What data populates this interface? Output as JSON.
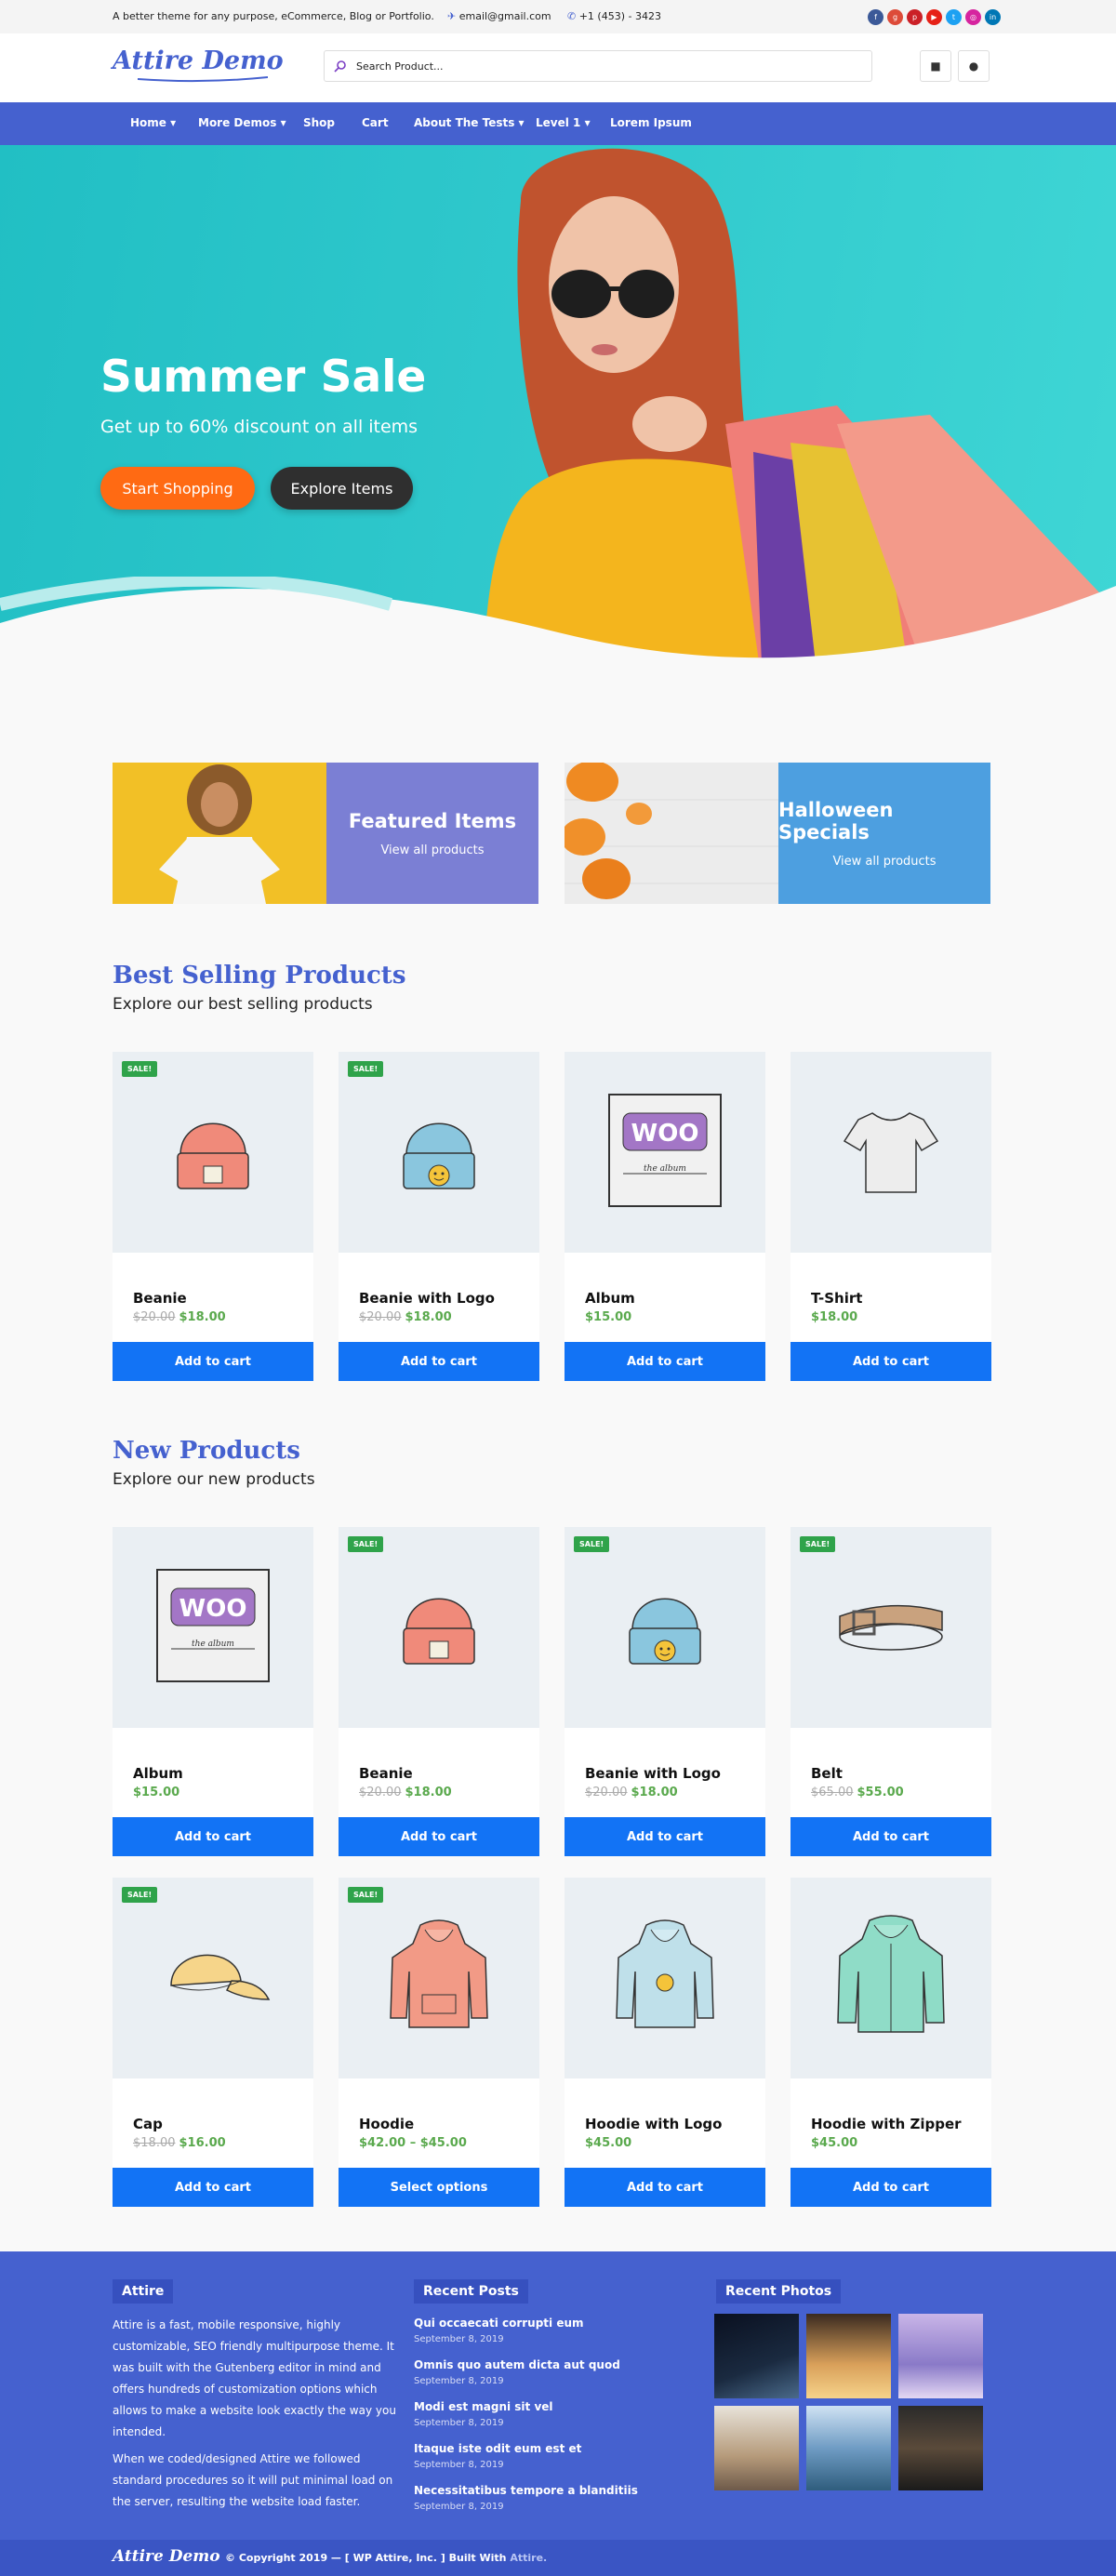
{
  "topbar": {
    "tagline": "A better theme for any purpose, eCommerce, Blog or Portfolio.",
    "email": "email@gmail.com",
    "phone": "+1 (453) - 3423",
    "social_icons": [
      "facebook-icon",
      "google-icon",
      "pinterest-icon",
      "youtube-icon",
      "twitter-icon",
      "instagram-icon",
      "linkedin-icon"
    ]
  },
  "header": {
    "logo": "Attire Demo",
    "search_placeholder": "Search Product...",
    "cart_icon": "bag-icon",
    "account_icon": "user-icon"
  },
  "nav": {
    "items": [
      {
        "label": "Home",
        "dropdown": true
      },
      {
        "label": "More Demos",
        "dropdown": true
      },
      {
        "label": "Shop",
        "dropdown": false
      },
      {
        "label": "Cart",
        "dropdown": false
      },
      {
        "label": "About The Tests",
        "dropdown": true
      },
      {
        "label": "Level 1",
        "dropdown": true
      },
      {
        "label": "Lorem Ipsum",
        "dropdown": false
      }
    ]
  },
  "hero": {
    "title": "Summer Sale",
    "subtitle": "Get up to 60% discount on all items",
    "primary_button": "Start Shopping",
    "secondary_button": "Explore Items"
  },
  "promos": [
    {
      "title": "Featured Items",
      "link": "View all products",
      "color": "#7b7fd4"
    },
    {
      "title": "Halloween Specials",
      "link": "View all products",
      "color": "#4d9fe0"
    }
  ],
  "best_selling": {
    "title": "Best Selling Products",
    "subtitle": "Explore our best selling products",
    "products": [
      {
        "name": "Beanie",
        "old_price": "$20.00",
        "price": "$18.00",
        "sale": "SALE!",
        "button": "Add to cart",
        "icon": "beanie-icon"
      },
      {
        "name": "Beanie with Logo",
        "old_price": "$20.00",
        "price": "$18.00",
        "sale": "SALE!",
        "button": "Add to cart",
        "icon": "beanie-logo-icon"
      },
      {
        "name": "Album",
        "old_price": "",
        "price": "$15.00",
        "sale": "",
        "button": "Add to cart",
        "icon": "album-icon"
      },
      {
        "name": "T-Shirt",
        "old_price": "",
        "price": "$18.00",
        "sale": "",
        "button": "Add to cart",
        "icon": "tshirt-icon"
      }
    ]
  },
  "new_products": {
    "title": "New Products",
    "subtitle": "Explore our new products",
    "products": [
      {
        "name": "Album",
        "old_price": "",
        "price": "$15.00",
        "sale": "",
        "button": "Add to cart",
        "icon": "album-icon"
      },
      {
        "name": "Beanie",
        "old_price": "$20.00",
        "price": "$18.00",
        "sale": "SALE!",
        "button": "Add to cart",
        "icon": "beanie-icon"
      },
      {
        "name": "Beanie with Logo",
        "old_price": "$20.00",
        "price": "$18.00",
        "sale": "SALE!",
        "button": "Add to cart",
        "icon": "beanie-logo-icon"
      },
      {
        "name": "Belt",
        "old_price": "$65.00",
        "price": "$55.00",
        "sale": "SALE!",
        "button": "Add to cart",
        "icon": "belt-icon"
      },
      {
        "name": "Cap",
        "old_price": "$18.00",
        "price": "$16.00",
        "sale": "SALE!",
        "button": "Add to cart",
        "icon": "cap-icon"
      },
      {
        "name": "Hoodie",
        "old_price": "",
        "price": "$42.00 – $45.00",
        "sale": "SALE!",
        "button": "Select options",
        "icon": "hoodie-icon"
      },
      {
        "name": "Hoodie with Logo",
        "old_price": "",
        "price": "$45.00",
        "sale": "",
        "button": "Add to cart",
        "icon": "hoodie-logo-icon"
      },
      {
        "name": "Hoodie with Zipper",
        "old_price": "",
        "price": "$45.00",
        "sale": "",
        "button": "Add to cart",
        "icon": "hoodie-zipper-icon"
      }
    ]
  },
  "footer": {
    "about_title": "Attire",
    "about_p1": "Attire is a fast, mobile responsive, highly customizable, SEO friendly multipurpose theme. It was built with the Gutenberg editor in mind and offers hundreds of customization options which allows to make a website look exactly the way you intended.",
    "about_p2": "When we coded/designed Attire we followed standard procedures so it will put minimal load on the server, resulting the website load faster.",
    "posts_title": "Recent Posts",
    "posts": [
      {
        "title": "Qui occaecati corrupti eum",
        "date": "September 8, 2019"
      },
      {
        "title": "Omnis quo autem dicta aut quod",
        "date": "September 8, 2019"
      },
      {
        "title": "Modi est magni sit vel",
        "date": "September 8, 2019"
      },
      {
        "title": "Itaque iste odit eum est et",
        "date": "September 8, 2019"
      },
      {
        "title": "Necessitatibus tempore a blanditiis",
        "date": "September 8, 2019"
      }
    ],
    "photos_title": "Recent Photos"
  },
  "bottombar": {
    "logo": "Attire Demo",
    "copyright": "© Copyright 2019 — [ WP Attire, Inc. ] Built With",
    "link": "Attire."
  }
}
